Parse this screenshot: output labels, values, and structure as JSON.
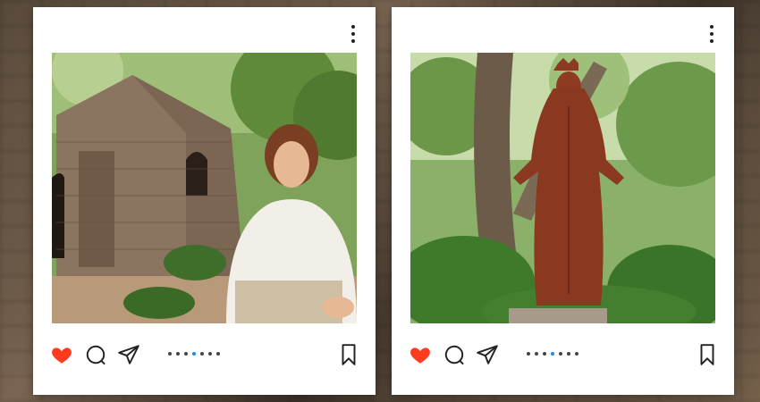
{
  "colors": {
    "heart": "#ff3b1f",
    "active_dot": "#1a8de6",
    "dot": "#444444",
    "icon": "#222222"
  },
  "posts": [
    {
      "photo": "house-of-virgin-mary-woman",
      "icons": [
        "more-vert-icon",
        "heart-icon",
        "comment-icon",
        "share-icon",
        "bookmark-icon"
      ],
      "carousel": {
        "count": 7,
        "active": 4
      }
    },
    {
      "photo": "virgin-mary-statue",
      "icons": [
        "more-vert-icon",
        "heart-icon",
        "comment-icon",
        "share-icon",
        "bookmark-icon"
      ],
      "carousel": {
        "count": 7,
        "active": 4
      }
    }
  ]
}
